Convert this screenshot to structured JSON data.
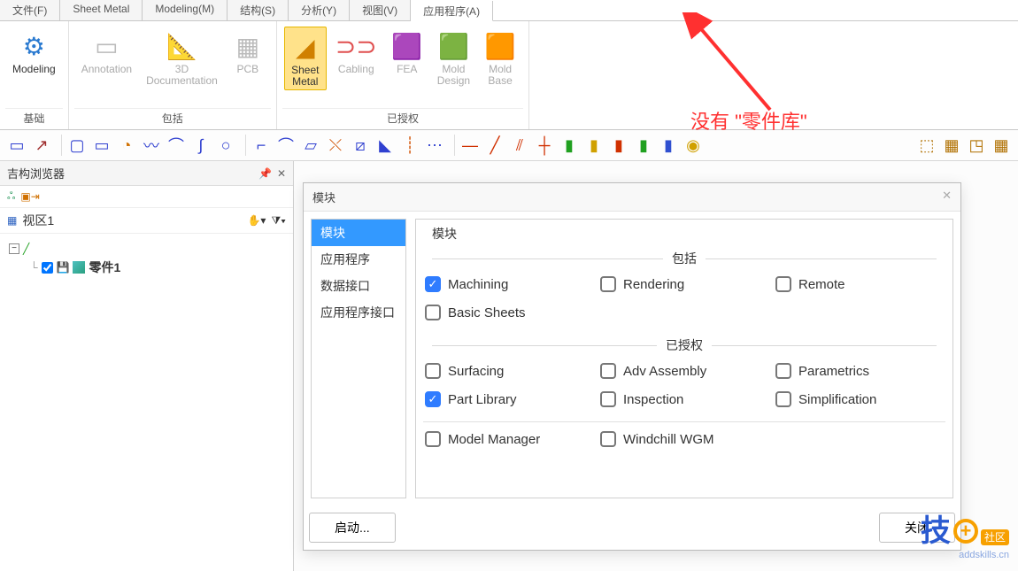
{
  "tabs": {
    "file": "文件(F)",
    "sheet_metal": "Sheet Metal",
    "modeling": "Modeling(M)",
    "structure": "结构(S)",
    "analysis": "分析(Y)",
    "view": "视图(V)",
    "application": "应用程序(A)"
  },
  "ribbon": {
    "modeling": "Modeling",
    "annotation": "Annotation",
    "doc3d": "3D\nDocumentation",
    "pcb": "PCB",
    "sheet_metal": "Sheet\nMetal",
    "cabling": "Cabling",
    "fea": "FEA",
    "mold_design": "Mold\nDesign",
    "mold_base": "Mold\nBase",
    "group_basic": "基础",
    "group_include": "包括",
    "group_licensed": "已授权"
  },
  "side": {
    "title": "吉构浏览器",
    "viewport": "视区1",
    "part": "零件1"
  },
  "dialog": {
    "title": "模块",
    "panel_legend": "模块",
    "list": [
      "模块",
      "应用程序",
      "数据接口",
      "应用程序接口"
    ],
    "section_include": "包括",
    "section_licensed": "已授权",
    "include_items": [
      {
        "label": "Machining",
        "checked": true
      },
      {
        "label": "Rendering",
        "checked": false
      },
      {
        "label": "Remote",
        "checked": false
      },
      {
        "label": "Basic Sheets",
        "checked": false
      }
    ],
    "licensed_items": [
      {
        "label": "Surfacing",
        "checked": false
      },
      {
        "label": "Adv Assembly",
        "checked": false
      },
      {
        "label": "Parametrics",
        "checked": false
      },
      {
        "label": "Part Library",
        "checked": true
      },
      {
        "label": "Inspection",
        "checked": false
      },
      {
        "label": "Simplification",
        "checked": false
      }
    ],
    "extra_items": [
      {
        "label": "Model Manager",
        "checked": false
      },
      {
        "label": "Windchill WGM",
        "checked": false
      }
    ],
    "btn_start": "启动...",
    "btn_close": "关闭"
  },
  "annotation": {
    "text": "没有  \"零件库\""
  },
  "watermark": {
    "logo": "技",
    "badge": "社区",
    "url": "addskills.cn"
  }
}
